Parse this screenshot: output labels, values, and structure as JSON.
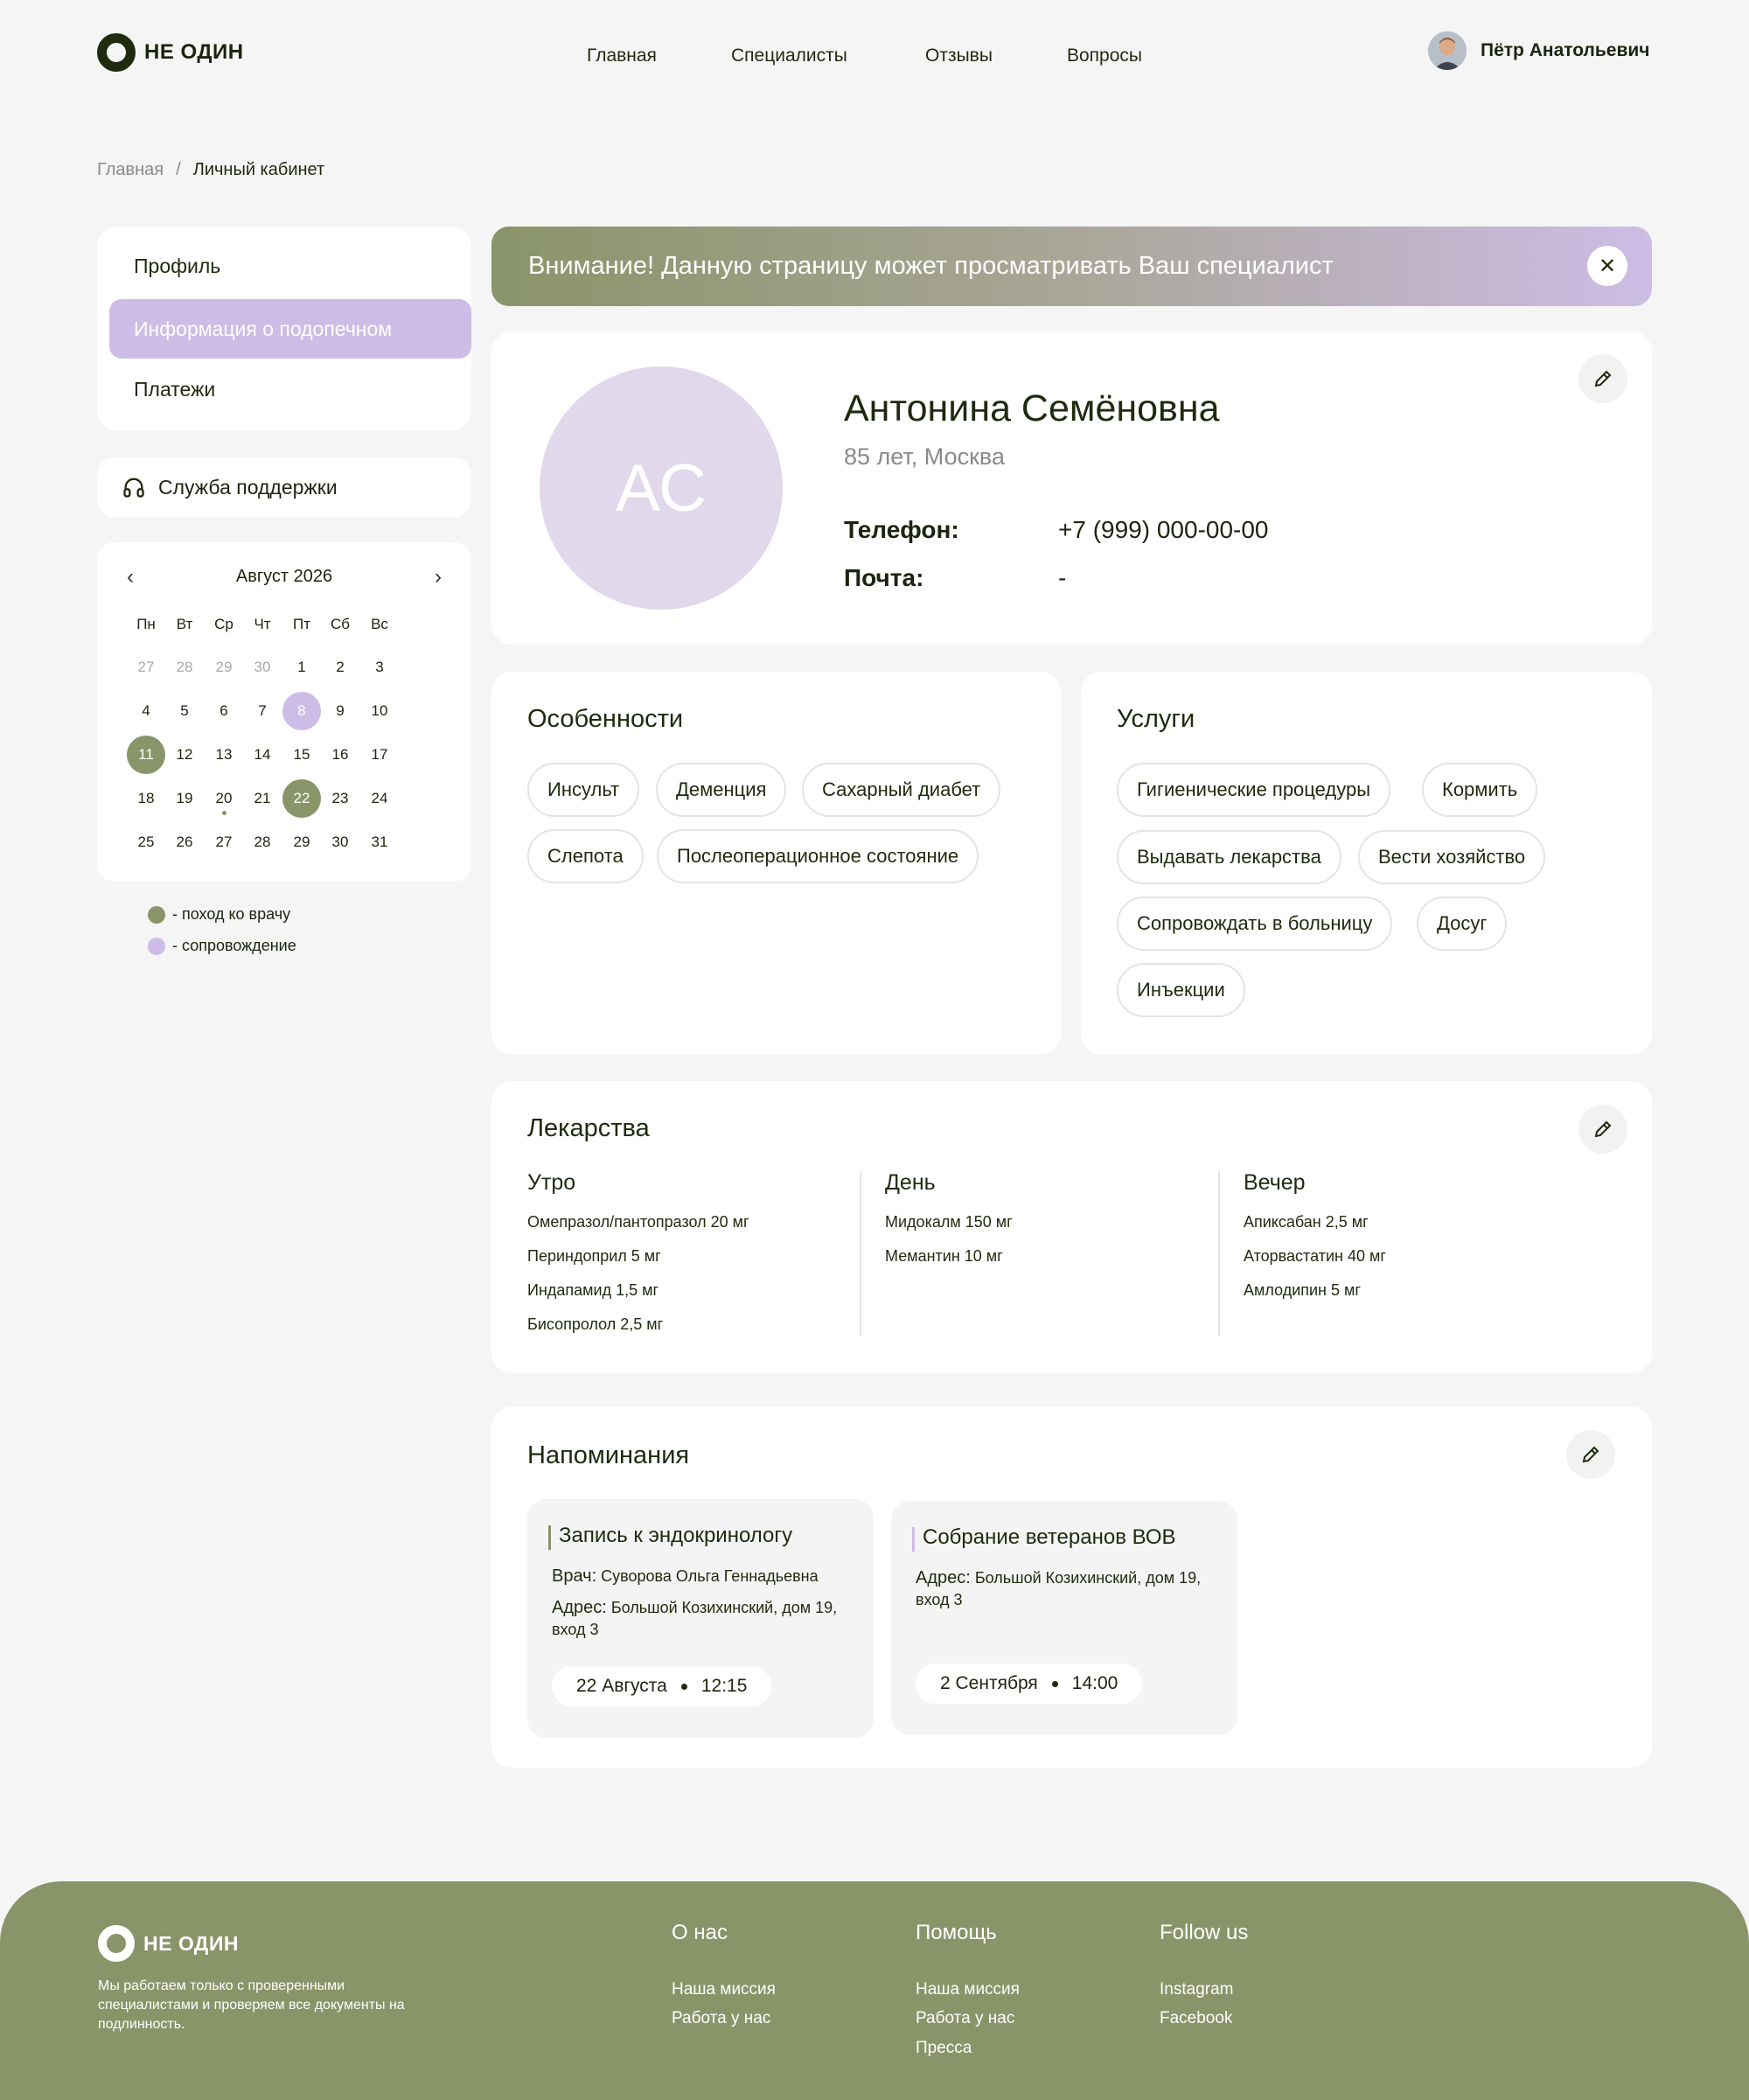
{
  "header": {
    "logo_text": "НЕ ОДИН",
    "nav": [
      "Главная",
      "Специалисты",
      "Отзывы",
      "Вопросы"
    ],
    "user_name": "Пётр Анатольевич"
  },
  "breadcrumb": {
    "home": "Главная",
    "sep": "/",
    "current": "Личный кабинет"
  },
  "sidebar": {
    "items": [
      {
        "label": "Профиль",
        "active": false
      },
      {
        "label": "Информация о подопечном",
        "active": true
      },
      {
        "label": "Платежи",
        "active": false
      }
    ],
    "support_label": "Служба поддержки"
  },
  "calendar": {
    "month_label": "Август 2026",
    "weekdays": [
      "Пн",
      "Вт",
      "Ср",
      "Чт",
      "Пт",
      "Сб",
      "Вс"
    ],
    "weeks": [
      [
        "27",
        "28",
        "29",
        "30",
        "1",
        "2",
        "3"
      ],
      [
        "4",
        "5",
        "6",
        "7",
        "8",
        "9",
        "10"
      ],
      [
        "11",
        "12",
        "13",
        "14",
        "15",
        "16",
        "17"
      ],
      [
        "18",
        "19",
        "20",
        "21",
        "22",
        "23",
        "24"
      ],
      [
        "25",
        "26",
        "27",
        "28",
        "29",
        "30",
        "31"
      ]
    ],
    "muted_days_first_week": 4,
    "doctor_days": [
      "11",
      "22"
    ],
    "escort_days": [
      "8"
    ],
    "today_marker": "20"
  },
  "legend": {
    "doctor": "- поход ко врачу",
    "escort": "- сопровождение",
    "doctor_color": "#8a9469",
    "escort_color": "#cdbde6"
  },
  "banner": {
    "text": "Внимание! Данную страницу может просматривать Ваш специалист",
    "close": "✕"
  },
  "profile": {
    "initials": "АС",
    "name": "Антонина Семёновна",
    "subtitle": "85 лет, Москва",
    "phone_label": "Телефон:",
    "phone": "+7 (999) 000-00-00",
    "email_label": "Почта:",
    "email": "-"
  },
  "features": {
    "title": "Особенности",
    "chips": [
      "Инсульт",
      "Деменция",
      "Сахарный диабет",
      "Слепота",
      "Послеоперационное состояние"
    ]
  },
  "services": {
    "title": "Услуги",
    "chips": [
      "Гигиенические процедуры",
      "Кормить",
      "Выдавать лекарства",
      "Вести хозяйство",
      "Сопровождать в больницу",
      "Досуг",
      "Инъекции"
    ]
  },
  "medicines": {
    "title": "Лекарства",
    "columns": [
      {
        "title": "Утро",
        "items": [
          "Омепразол/пантопразол 20 мг",
          "Периндоприл 5 мг",
          "Индапамид 1,5 мг",
          "Бисопролол 2,5 мг"
        ]
      },
      {
        "title": "День",
        "items": [
          "Мидокалм 150 мг",
          "Мемантин 10 мг"
        ]
      },
      {
        "title": "Вечер",
        "items": [
          "Апиксабан 2,5 мг",
          "Аторвастатин 40 мг",
          "Амлодипин 5 мг"
        ]
      }
    ]
  },
  "reminders": {
    "title": "Напоминания",
    "cards": [
      {
        "title": "Запись к эндокринологу",
        "doctor_label": "Врач:",
        "doctor": "Суворова Ольга Геннадьевна",
        "address_label": "Адрес:",
        "address": "Большой Козихинский, дом 19, вход 3",
        "date": "22 Августа",
        "time": "12:15",
        "accent": "#8a9469"
      },
      {
        "title": "Собрание ветеранов ВОВ",
        "address_label": "Адрес:",
        "address": "Большой Козихинский, дом 19, вход 3",
        "date": "2 Сентября",
        "time": "14:00",
        "accent": "#cdbde6"
      }
    ]
  },
  "footer": {
    "logo_text": "НЕ ОДИН",
    "tagline": "Мы работаем только с проверенными специалистами и проверяем все документы на подлинность.",
    "cols": [
      {
        "title": "О нас",
        "links": [
          "Наша миссия",
          "Работа у нас"
        ]
      },
      {
        "title": "Помощь",
        "links": [
          "Наша миссия",
          "Работа у нас",
          "Пресса"
        ]
      },
      {
        "title": "Follow us",
        "links": [
          "Instagram",
          "Facebook"
        ]
      }
    ]
  },
  "colors": {
    "accent_green": "#8a9469",
    "accent_lavender": "#cdbde6",
    "dark": "#1f2a0e"
  }
}
